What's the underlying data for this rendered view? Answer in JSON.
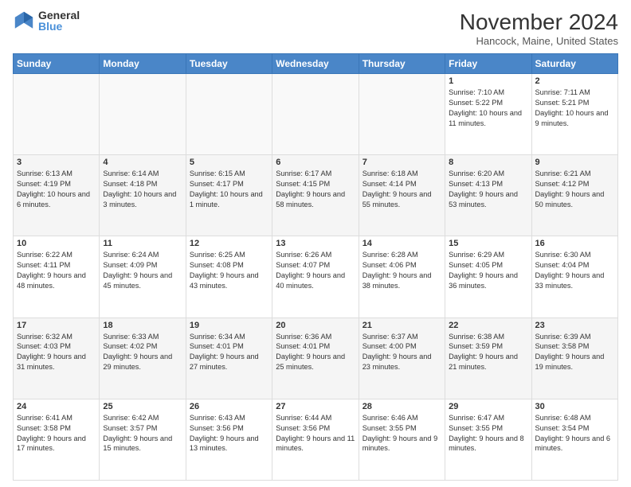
{
  "logo": {
    "general": "General",
    "blue": "Blue"
  },
  "title": "November 2024",
  "location": "Hancock, Maine, United States",
  "days_header": [
    "Sunday",
    "Monday",
    "Tuesday",
    "Wednesday",
    "Thursday",
    "Friday",
    "Saturday"
  ],
  "weeks": [
    [
      {
        "day": "",
        "info": ""
      },
      {
        "day": "",
        "info": ""
      },
      {
        "day": "",
        "info": ""
      },
      {
        "day": "",
        "info": ""
      },
      {
        "day": "",
        "info": ""
      },
      {
        "day": "1",
        "info": "Sunrise: 7:10 AM\nSunset: 5:22 PM\nDaylight: 10 hours and 11 minutes."
      },
      {
        "day": "2",
        "info": "Sunrise: 7:11 AM\nSunset: 5:21 PM\nDaylight: 10 hours and 9 minutes."
      }
    ],
    [
      {
        "day": "3",
        "info": "Sunrise: 6:13 AM\nSunset: 4:19 PM\nDaylight: 10 hours and 6 minutes."
      },
      {
        "day": "4",
        "info": "Sunrise: 6:14 AM\nSunset: 4:18 PM\nDaylight: 10 hours and 3 minutes."
      },
      {
        "day": "5",
        "info": "Sunrise: 6:15 AM\nSunset: 4:17 PM\nDaylight: 10 hours and 1 minute."
      },
      {
        "day": "6",
        "info": "Sunrise: 6:17 AM\nSunset: 4:15 PM\nDaylight: 9 hours and 58 minutes."
      },
      {
        "day": "7",
        "info": "Sunrise: 6:18 AM\nSunset: 4:14 PM\nDaylight: 9 hours and 55 minutes."
      },
      {
        "day": "8",
        "info": "Sunrise: 6:20 AM\nSunset: 4:13 PM\nDaylight: 9 hours and 53 minutes."
      },
      {
        "day": "9",
        "info": "Sunrise: 6:21 AM\nSunset: 4:12 PM\nDaylight: 9 hours and 50 minutes."
      }
    ],
    [
      {
        "day": "10",
        "info": "Sunrise: 6:22 AM\nSunset: 4:11 PM\nDaylight: 9 hours and 48 minutes."
      },
      {
        "day": "11",
        "info": "Sunrise: 6:24 AM\nSunset: 4:09 PM\nDaylight: 9 hours and 45 minutes."
      },
      {
        "day": "12",
        "info": "Sunrise: 6:25 AM\nSunset: 4:08 PM\nDaylight: 9 hours and 43 minutes."
      },
      {
        "day": "13",
        "info": "Sunrise: 6:26 AM\nSunset: 4:07 PM\nDaylight: 9 hours and 40 minutes."
      },
      {
        "day": "14",
        "info": "Sunrise: 6:28 AM\nSunset: 4:06 PM\nDaylight: 9 hours and 38 minutes."
      },
      {
        "day": "15",
        "info": "Sunrise: 6:29 AM\nSunset: 4:05 PM\nDaylight: 9 hours and 36 minutes."
      },
      {
        "day": "16",
        "info": "Sunrise: 6:30 AM\nSunset: 4:04 PM\nDaylight: 9 hours and 33 minutes."
      }
    ],
    [
      {
        "day": "17",
        "info": "Sunrise: 6:32 AM\nSunset: 4:03 PM\nDaylight: 9 hours and 31 minutes."
      },
      {
        "day": "18",
        "info": "Sunrise: 6:33 AM\nSunset: 4:02 PM\nDaylight: 9 hours and 29 minutes."
      },
      {
        "day": "19",
        "info": "Sunrise: 6:34 AM\nSunset: 4:01 PM\nDaylight: 9 hours and 27 minutes."
      },
      {
        "day": "20",
        "info": "Sunrise: 6:36 AM\nSunset: 4:01 PM\nDaylight: 9 hours and 25 minutes."
      },
      {
        "day": "21",
        "info": "Sunrise: 6:37 AM\nSunset: 4:00 PM\nDaylight: 9 hours and 23 minutes."
      },
      {
        "day": "22",
        "info": "Sunrise: 6:38 AM\nSunset: 3:59 PM\nDaylight: 9 hours and 21 minutes."
      },
      {
        "day": "23",
        "info": "Sunrise: 6:39 AM\nSunset: 3:58 PM\nDaylight: 9 hours and 19 minutes."
      }
    ],
    [
      {
        "day": "24",
        "info": "Sunrise: 6:41 AM\nSunset: 3:58 PM\nDaylight: 9 hours and 17 minutes."
      },
      {
        "day": "25",
        "info": "Sunrise: 6:42 AM\nSunset: 3:57 PM\nDaylight: 9 hours and 15 minutes."
      },
      {
        "day": "26",
        "info": "Sunrise: 6:43 AM\nSunset: 3:56 PM\nDaylight: 9 hours and 13 minutes."
      },
      {
        "day": "27",
        "info": "Sunrise: 6:44 AM\nSunset: 3:56 PM\nDaylight: 9 hours and 11 minutes."
      },
      {
        "day": "28",
        "info": "Sunrise: 6:46 AM\nSunset: 3:55 PM\nDaylight: 9 hours and 9 minutes."
      },
      {
        "day": "29",
        "info": "Sunrise: 6:47 AM\nSunset: 3:55 PM\nDaylight: 9 hours and 8 minutes."
      },
      {
        "day": "30",
        "info": "Sunrise: 6:48 AM\nSunset: 3:54 PM\nDaylight: 9 hours and 6 minutes."
      }
    ]
  ]
}
